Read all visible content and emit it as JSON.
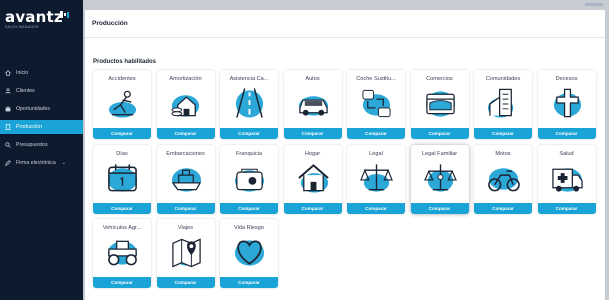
{
  "app": {
    "logo_text": "avantz",
    "logo_sub": "SALES MANAGER"
  },
  "sidebar": {
    "items": [
      {
        "label": "Inicio",
        "icon": "home-icon",
        "active": false
      },
      {
        "label": "Clientes",
        "icon": "user-icon",
        "active": false
      },
      {
        "label": "Oportunidades",
        "icon": "briefcase-icon",
        "active": false
      },
      {
        "label": "Producción",
        "icon": "document-icon",
        "active": true
      },
      {
        "label": "Presupuestos",
        "icon": "search-icon",
        "active": false
      },
      {
        "label": "Firma electrónica",
        "icon": "pen-icon",
        "active": false,
        "has_chevron": true
      }
    ]
  },
  "header": {
    "title": "Producción"
  },
  "main": {
    "section_title": "Productos habilitados",
    "button_label": "Comparar",
    "products": [
      {
        "name": "Accidentes",
        "icon": "accident-icon"
      },
      {
        "name": "Amortización",
        "icon": "house-coins-icon"
      },
      {
        "name": "Asistencia Ca...",
        "icon": "road-icon"
      },
      {
        "name": "Autos",
        "icon": "car-icon"
      },
      {
        "name": "Coche Sustitu...",
        "icon": "car-swap-icon"
      },
      {
        "name": "Comercios",
        "icon": "shop-icon"
      },
      {
        "name": "Comunidades",
        "icon": "building-icon"
      },
      {
        "name": "Decesos",
        "icon": "cross-icon"
      },
      {
        "name": "Días",
        "icon": "calendar-icon"
      },
      {
        "name": "Embarcaciones",
        "icon": "boat-icon"
      },
      {
        "name": "Franquicia",
        "icon": "franchise-icon"
      },
      {
        "name": "Hogar",
        "icon": "home-insurance-icon"
      },
      {
        "name": "Legal",
        "icon": "scales-icon"
      },
      {
        "name": "Legal Familiar",
        "icon": "family-scales-icon"
      },
      {
        "name": "Motos",
        "icon": "motorcycle-icon"
      },
      {
        "name": "Salud",
        "icon": "ambulance-icon"
      },
      {
        "name": "Vehículos Agr...",
        "icon": "tractor-icon"
      },
      {
        "name": "Viajes",
        "icon": "map-pin-icon"
      },
      {
        "name": "Vida Riesgo",
        "icon": "heart-icon"
      }
    ]
  },
  "colors": {
    "accent": "#1aa3d6",
    "sidebar_bg": "#0e1a2e",
    "illustration_blob": "#2ba8d8",
    "illustration_stroke": "#1b2433"
  }
}
